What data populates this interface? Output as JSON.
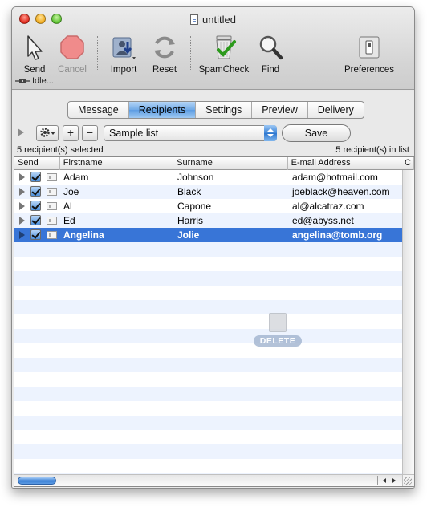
{
  "window": {
    "title": "untitled"
  },
  "toolbar": {
    "items": [
      {
        "label": "Send",
        "icon": "send-icon",
        "enabled": true
      },
      {
        "label": "Cancel",
        "icon": "stop-icon",
        "enabled": false
      },
      {
        "label": "Import",
        "icon": "import-icon",
        "enabled": true
      },
      {
        "label": "Reset",
        "icon": "reset-icon",
        "enabled": true
      },
      {
        "label": "SpamCheck",
        "icon": "trash-check-icon",
        "enabled": true
      },
      {
        "label": "Find",
        "icon": "magnifier-icon",
        "enabled": true
      },
      {
        "label": "Preferences",
        "icon": "switch-icon",
        "enabled": true
      }
    ]
  },
  "status": {
    "text": "Idle..."
  },
  "tabs": [
    {
      "label": "Message",
      "active": false
    },
    {
      "label": "Recipients",
      "active": true
    },
    {
      "label": "Settings",
      "active": false
    },
    {
      "label": "Preview",
      "active": false
    },
    {
      "label": "Delivery",
      "active": false
    }
  ],
  "list_toolbar": {
    "plus": "+",
    "minus": "−",
    "list_select": "Sample list",
    "save_label": "Save"
  },
  "counts": {
    "selected": "5 recipient(s) selected",
    "in_list": "5 recipient(s) in list"
  },
  "table": {
    "columns": [
      "Send",
      "Firstname",
      "Surname",
      "E-mail Address",
      "C"
    ],
    "rows": [
      {
        "checked": true,
        "firstname": "Adam",
        "surname": "Johnson",
        "email": "adam@hotmail.com",
        "selected": false
      },
      {
        "checked": true,
        "firstname": "Joe",
        "surname": "Black",
        "email": "joeblack@heaven.com",
        "selected": false
      },
      {
        "checked": true,
        "firstname": "Al",
        "surname": "Capone",
        "email": "al@alcatraz.com",
        "selected": false
      },
      {
        "checked": true,
        "firstname": "Ed",
        "surname": "Harris",
        "email": "ed@abyss.net",
        "selected": false
      },
      {
        "checked": true,
        "firstname": "Angelina",
        "surname": "Jolie",
        "email": "angelina@tomb.org",
        "selected": true
      }
    ]
  },
  "drag_overlay": {
    "label": "DELETE"
  },
  "colors": {
    "selection": "#3875d7",
    "tab_active": "#6fa9e6",
    "stripe": "#edf3fe"
  }
}
